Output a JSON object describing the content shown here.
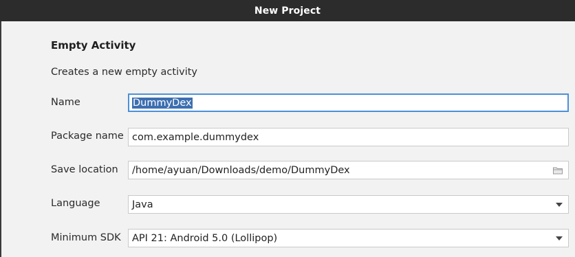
{
  "window": {
    "title": "New Project"
  },
  "template": {
    "heading": "Empty Activity",
    "description": "Creates a new empty activity"
  },
  "form": {
    "name": {
      "label": "Name",
      "value": "DummyDex"
    },
    "package_name": {
      "label": "Package name",
      "value": "com.example.dummydex"
    },
    "save_location": {
      "label": "Save location",
      "value": "/home/ayuan/Downloads/demo/DummyDex",
      "icon": "folder-icon"
    },
    "language": {
      "label": "Language",
      "value": "Java",
      "icon": "chevron-down-icon"
    },
    "minimum_sdk": {
      "label": "Minimum SDK",
      "value": "API 21: Android 5.0 (Lollipop)",
      "icon": "chevron-down-icon"
    }
  },
  "colors": {
    "titlebar": "#2c2c2c",
    "focus_border": "#4a90d9",
    "selection": "#3d6fb0"
  }
}
